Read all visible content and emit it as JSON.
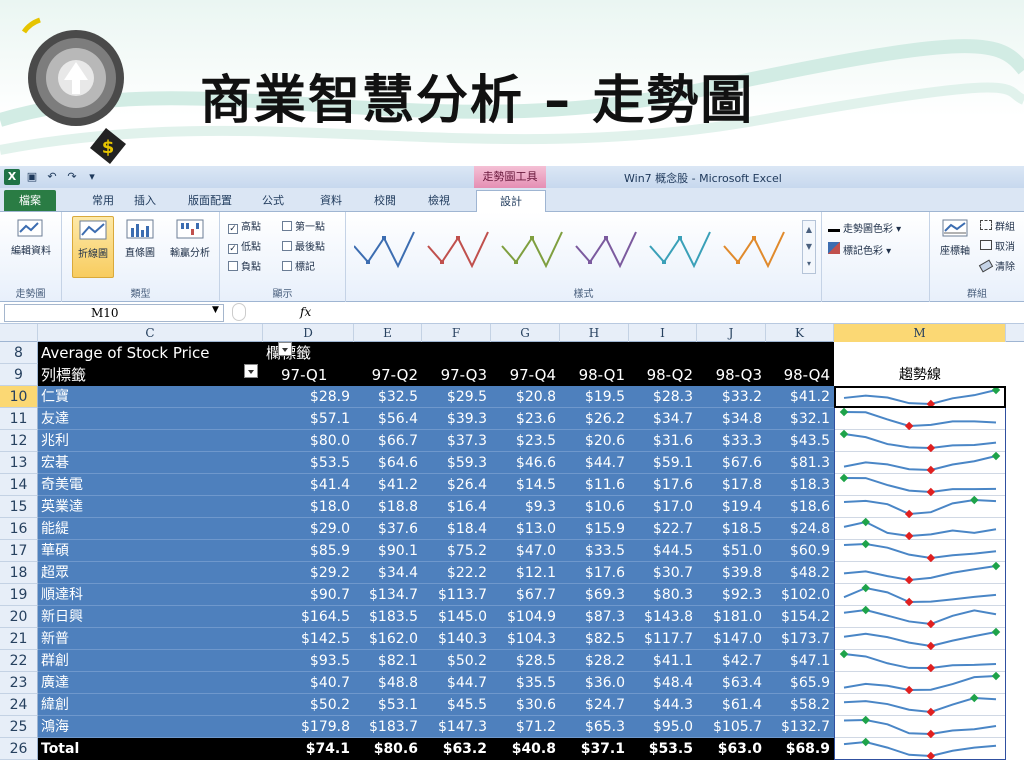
{
  "slide": {
    "title": "商業智慧分析 – 走勢圖"
  },
  "titlebar": {
    "context_tool": "走勢圖工具",
    "window_title": "Win7 概念股 - Microsoft Excel"
  },
  "tabs": {
    "file": "檔案",
    "home": "常用",
    "insert": "插入",
    "layout": "版面配置",
    "formulas": "公式",
    "data": "資料",
    "review": "校閱",
    "view": "檢視",
    "design": "設計"
  },
  "ribbon": {
    "edit_data": "編輯資料",
    "group_sparkline": "走勢圖",
    "line": "折線圖",
    "column": "直條圖",
    "winloss": "輸贏分析",
    "group_type": "類型",
    "high_point": "高點",
    "low_point": "低點",
    "negative_point": "負點",
    "first_point": "第一點",
    "last_point": "最後點",
    "markers": "標記",
    "group_show": "顯示",
    "group_style": "樣式",
    "sparkline_color": "走勢圖色彩",
    "marker_color": "標記色彩",
    "axis": "座標軸",
    "group_btn": "群組",
    "ungroup_btn": "取消",
    "clear_btn": "清除",
    "group_group": "群組",
    "style_colors": [
      "#3c6db1",
      "#c0504d",
      "#7f9f3f",
      "#7b5a9e",
      "#3aa0b8",
      "#e08a2c"
    ]
  },
  "formula_bar": {
    "cell_ref": "M10",
    "fx": "fx"
  },
  "columns": [
    "C",
    "D",
    "E",
    "F",
    "G",
    "H",
    "I",
    "J",
    "K",
    "M"
  ],
  "row_numbers": [
    "8",
    "9",
    "10",
    "11",
    "12",
    "13",
    "14",
    "15",
    "16",
    "17",
    "18",
    "19",
    "20",
    "21",
    "22",
    "23",
    "24",
    "25",
    "26"
  ],
  "pivot": {
    "row8_label": "Average of Stock Price",
    "col_field": "欄標籤",
    "row_field": "列標籤",
    "quarters": [
      "97-Q1",
      "97-Q2",
      "97-Q3",
      "97-Q4",
      "98-Q1",
      "98-Q2",
      "98-Q3",
      "98-Q4"
    ],
    "trend_header": "趨勢線",
    "rows": [
      {
        "name": "仁寶",
        "values": [
          "$28.9",
          "$32.5",
          "$29.5",
          "$20.8",
          "$19.5",
          "$28.3",
          "$33.2",
          "$41.2"
        ],
        "nums": [
          28.9,
          32.5,
          29.5,
          20.8,
          19.5,
          28.3,
          33.2,
          41.2
        ]
      },
      {
        "name": "友達",
        "values": [
          "$57.1",
          "$56.4",
          "$39.3",
          "$23.6",
          "$26.2",
          "$34.7",
          "$34.8",
          "$32.1"
        ],
        "nums": [
          57.1,
          56.4,
          39.3,
          23.6,
          26.2,
          34.7,
          34.8,
          32.1
        ]
      },
      {
        "name": "兆利",
        "values": [
          "$80.0",
          "$66.7",
          "$37.3",
          "$23.5",
          "$20.6",
          "$31.6",
          "$33.3",
          "$43.5"
        ],
        "nums": [
          80.0,
          66.7,
          37.3,
          23.5,
          20.6,
          31.6,
          33.3,
          43.5
        ]
      },
      {
        "name": "宏碁",
        "values": [
          "$53.5",
          "$64.6",
          "$59.3",
          "$46.6",
          "$44.7",
          "$59.1",
          "$67.6",
          "$81.3"
        ],
        "nums": [
          53.5,
          64.6,
          59.3,
          46.6,
          44.7,
          59.1,
          67.6,
          81.3
        ]
      },
      {
        "name": "奇美電",
        "values": [
          "$41.4",
          "$41.2",
          "$26.4",
          "$14.5",
          "$11.6",
          "$17.6",
          "$17.8",
          "$18.3"
        ],
        "nums": [
          41.4,
          41.2,
          26.4,
          14.5,
          11.6,
          17.6,
          17.8,
          18.3
        ]
      },
      {
        "name": "英業達",
        "values": [
          "$18.0",
          "$18.8",
          "$16.4",
          "$9.3",
          "$10.6",
          "$17.0",
          "$19.4",
          "$18.6"
        ],
        "nums": [
          18.0,
          18.8,
          16.4,
          9.3,
          10.6,
          17.0,
          19.4,
          18.6
        ]
      },
      {
        "name": "能緹",
        "values": [
          "$29.0",
          "$37.6",
          "$18.4",
          "$13.0",
          "$15.9",
          "$22.7",
          "$18.5",
          "$24.8"
        ],
        "nums": [
          29.0,
          37.6,
          18.4,
          13.0,
          15.9,
          22.7,
          18.5,
          24.8
        ]
      },
      {
        "name": "華碩",
        "values": [
          "$85.9",
          "$90.1",
          "$75.2",
          "$47.0",
          "$33.5",
          "$44.5",
          "$51.0",
          "$60.9"
        ],
        "nums": [
          85.9,
          90.1,
          75.2,
          47.0,
          33.5,
          44.5,
          51.0,
          60.9
        ]
      },
      {
        "name": "超眾",
        "values": [
          "$29.2",
          "$34.4",
          "$22.2",
          "$12.1",
          "$17.6",
          "$30.7",
          "$39.8",
          "$48.2"
        ],
        "nums": [
          29.2,
          34.4,
          22.2,
          12.1,
          17.6,
          30.7,
          39.8,
          48.2
        ]
      },
      {
        "name": "順達科",
        "values": [
          "$90.7",
          "$134.7",
          "$113.7",
          "$67.7",
          "$69.3",
          "$80.3",
          "$92.3",
          "$102.0"
        ],
        "nums": [
          90.7,
          134.7,
          113.7,
          67.7,
          69.3,
          80.3,
          92.3,
          102.0
        ]
      },
      {
        "name": "新日興",
        "values": [
          "$164.5",
          "$183.5",
          "$145.0",
          "$104.9",
          "$87.3",
          "$143.8",
          "$181.0",
          "$154.2"
        ],
        "nums": [
          164.5,
          183.5,
          145.0,
          104.9,
          87.3,
          143.8,
          181.0,
          154.2
        ]
      },
      {
        "name": "新普",
        "values": [
          "$142.5",
          "$162.0",
          "$140.3",
          "$104.3",
          "$82.5",
          "$117.7",
          "$147.0",
          "$173.7"
        ],
        "nums": [
          142.5,
          162.0,
          140.3,
          104.3,
          82.5,
          117.7,
          147.0,
          173.7
        ]
      },
      {
        "name": "群創",
        "values": [
          "$93.5",
          "$82.1",
          "$50.2",
          "$28.5",
          "$28.2",
          "$41.1",
          "$42.7",
          "$47.1"
        ],
        "nums": [
          93.5,
          82.1,
          50.2,
          28.5,
          28.2,
          41.1,
          42.7,
          47.1
        ]
      },
      {
        "name": "廣達",
        "values": [
          "$40.7",
          "$48.8",
          "$44.7",
          "$35.5",
          "$36.0",
          "$48.4",
          "$63.4",
          "$65.9"
        ],
        "nums": [
          40.7,
          48.8,
          44.7,
          35.5,
          36.0,
          48.4,
          63.4,
          65.9
        ]
      },
      {
        "name": "緯創",
        "values": [
          "$50.2",
          "$53.1",
          "$45.5",
          "$30.6",
          "$24.7",
          "$44.3",
          "$61.4",
          "$58.2"
        ],
        "nums": [
          50.2,
          53.1,
          45.5,
          30.6,
          24.7,
          44.3,
          61.4,
          58.2
        ]
      },
      {
        "name": "鴻海",
        "values": [
          "$179.8",
          "$183.7",
          "$147.3",
          "$71.2",
          "$65.3",
          "$95.0",
          "$105.7",
          "$132.7"
        ],
        "nums": [
          179.8,
          183.7,
          147.3,
          71.2,
          65.3,
          95.0,
          105.7,
          132.7
        ]
      }
    ],
    "total": {
      "name": "Total",
      "values": [
        "$74.1",
        "$80.6",
        "$63.2",
        "$40.8",
        "$37.1",
        "$53.5",
        "$63.0",
        "$68.9"
      ],
      "nums": [
        74.1,
        80.6,
        63.2,
        40.8,
        37.1,
        53.5,
        63.0,
        68.9
      ]
    }
  },
  "colors": {
    "line": "#4a86c6",
    "high": "#1ea34a",
    "low": "#e02020",
    "table_blue": "#4e80bd"
  }
}
